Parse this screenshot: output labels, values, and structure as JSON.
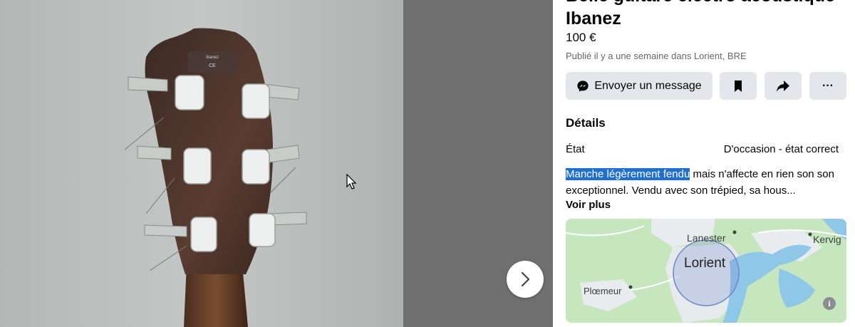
{
  "listing": {
    "title": "Belle guitare électro acoustique Ibanez",
    "price": "100 €",
    "meta": "Publié il y a une semaine dans Lorient, BRE"
  },
  "actions": {
    "message_label": "Envoyer un message",
    "more_label": "···"
  },
  "details": {
    "heading": "Détails",
    "condition_label": "État",
    "condition_value": "D'occasion - état correct",
    "description_highlight": "Manche légèrement fendu",
    "description_rest": " mais n'affecte en rien son son exceptionnel. Vendu avec son trépied, sa hous...",
    "see_more": "Voir plus"
  },
  "map": {
    "labels": {
      "lanester": "Lanester",
      "kervig": "Kervig",
      "lorient": "Lorient",
      "ploemeur": "Plœmeur"
    }
  },
  "icons": {
    "messenger": "messenger-icon",
    "save": "bookmark-icon",
    "share": "share-icon",
    "next": "chevron-right-icon",
    "info": "info-icon",
    "cursor": "mouse-cursor-icon"
  },
  "colors": {
    "button_bg": "#e4e6eb",
    "text_secondary": "#65676b",
    "selection": "#1f6fd1"
  }
}
